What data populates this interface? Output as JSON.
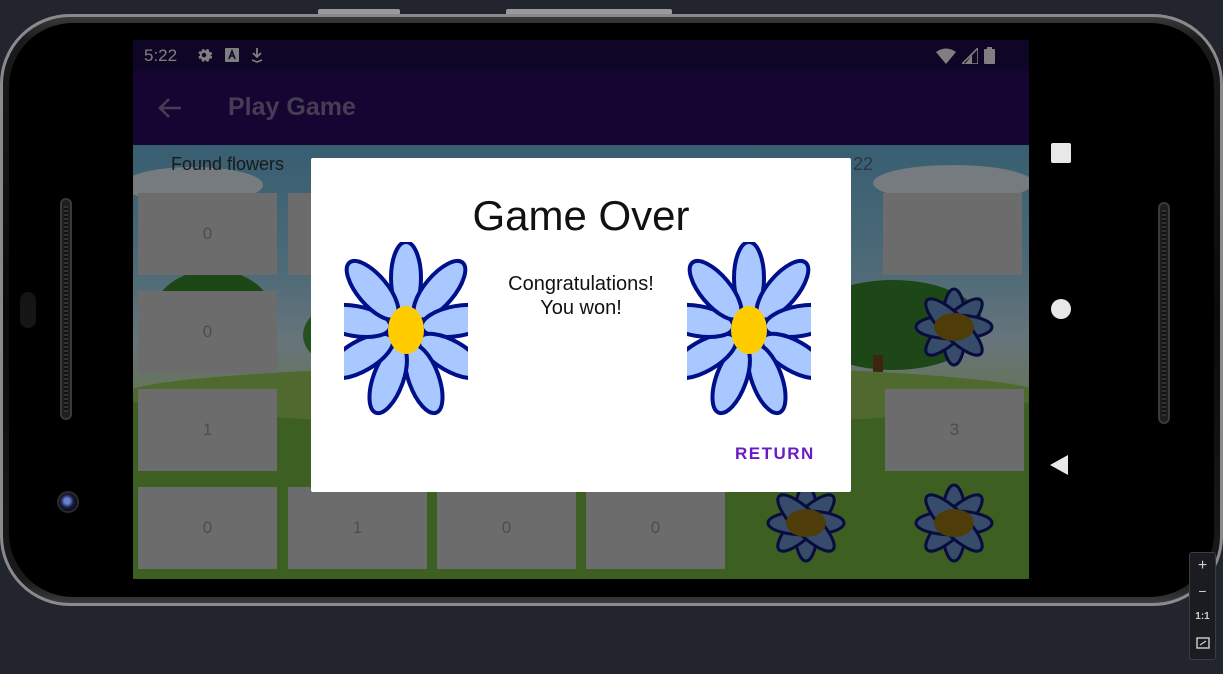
{
  "status_bar": {
    "time": "5:22",
    "left_icons": [
      "gear-icon",
      "keyboard-a-icon",
      "download-icon"
    ],
    "right_icons": [
      "wifi-icon",
      "cellular-icon",
      "battery-icon"
    ]
  },
  "app_bar": {
    "back_icon": "arrow-left-icon",
    "title": "Play Game"
  },
  "game": {
    "found_label": "Found flowers",
    "score_label": "22",
    "tiles": [
      {
        "value": "0"
      },
      {
        "value": "0"
      },
      {
        "value": "1"
      },
      {
        "value": "0"
      },
      {
        "value": "1"
      },
      {
        "value": "0"
      },
      {
        "value": "0"
      },
      {
        "value": "3"
      }
    ]
  },
  "dialog": {
    "title": "Game Over",
    "message_line1": "Congratulations!",
    "message_line2": "You won!",
    "return_label": "RETURN",
    "colors": {
      "petal_outer": "#000f8a",
      "petal_inner": "#a8c8ff",
      "center": "#ffcc00",
      "accent": "#6a1bc4"
    }
  },
  "emulator_toolbar": {
    "zoom_in": "+",
    "zoom_out": "−",
    "actual_size": "1:1"
  }
}
